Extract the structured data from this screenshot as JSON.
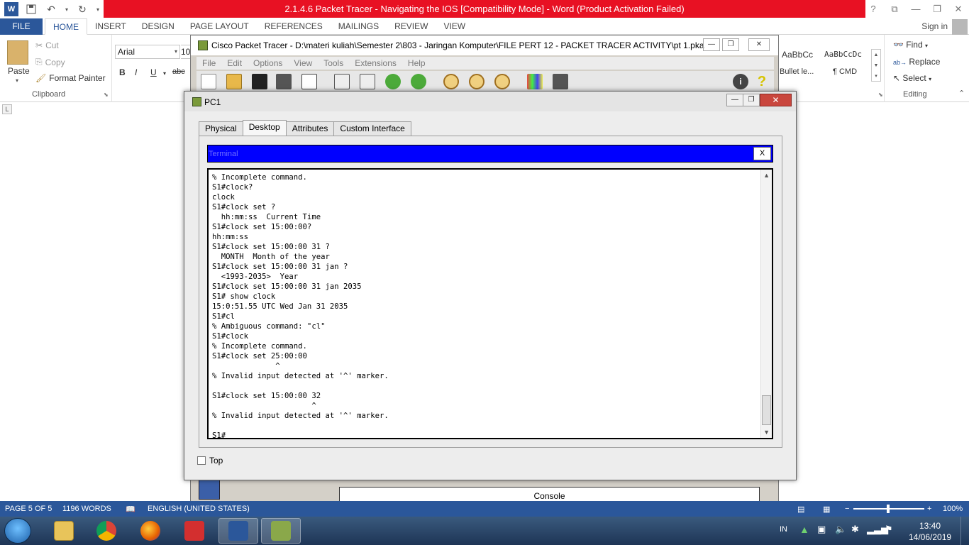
{
  "word": {
    "title": "2.1.4.6 Packet Tracer - Navigating the IOS [Compatibility Mode] -  Word (Product Activation Failed)",
    "controls": {
      "help": "?",
      "ribbon_opts": "⧉",
      "minimize": "—",
      "restore": "❐",
      "close": "✕"
    },
    "tabs": {
      "file": "FILE",
      "items": [
        "HOME",
        "INSERT",
        "DESIGN",
        "PAGE LAYOUT",
        "REFERENCES",
        "MAILINGS",
        "REVIEW",
        "VIEW"
      ]
    },
    "signin": "Sign in",
    "clipboard": {
      "paste": "Paste",
      "cut": "Cut",
      "copy": "Copy",
      "format_painter": "Format Painter",
      "label": "Clipboard"
    },
    "font": {
      "name": "Arial",
      "size": "10",
      "bold": "B",
      "italic": "I",
      "underline": "U",
      "strike": "abc"
    },
    "styles": {
      "style1_preview": "AaBbCc",
      "style1_name": "Bullet le...",
      "style2_preview": "AaBbCcDc",
      "style2_name": "¶ CMD"
    },
    "editing": {
      "find": "Find",
      "replace": "Replace",
      "select": "Select",
      "label": "Editing"
    },
    "ruler_tab": "L",
    "status": {
      "page": "PAGE 5 OF 5",
      "words": "1196 WORDS",
      "language": "ENGLISH (UNITED STATES)",
      "zoom": "100%"
    }
  },
  "packet_tracer": {
    "title": "Cisco Packet Tracer - D:\\materi kuliah\\Semester 2\\803 - Jaringan Komputer\\FILE PERT 12 - PACKET TRACER ACTIVITY\\pt 1.pka",
    "menus": [
      "File",
      "Edit",
      "Options",
      "View",
      "Tools",
      "Extensions",
      "Help"
    ],
    "console_label": "Console"
  },
  "pc1": {
    "title": "PC1",
    "tabs": [
      "Physical",
      "Desktop",
      "Attributes",
      "Custom Interface"
    ],
    "active_tab": "Desktop",
    "terminal_title": "Terminal",
    "terminal_close": "X",
    "terminal_lines": [
      "% Incomplete command.",
      "S1#clock?",
      "clock",
      "S1#clock set ?",
      "  hh:mm:ss  Current Time",
      "S1#clock set 15:00:00?",
      "hh:mm:ss",
      "S1#clock set 15:00:00 31 ?",
      "  MONTH  Month of the year",
      "S1#clock set 15:00:00 31 jan ?",
      "  <1993-2035>  Year",
      "S1#clock set 15:00:00 31 jan 2035",
      "S1# show clock",
      "15:0:51.55 UTC Wed Jan 31 2035",
      "S1#cl",
      "% Ambiguous command: \"cl\"",
      "S1#clock",
      "% Incomplete command.",
      "S1#clock set 25:00:00",
      "              ^",
      "% Invalid input detected at '^' marker.",
      "",
      "S1#clock set 15:00:00 32",
      "                      ^",
      "% Invalid input detected at '^' marker.",
      "",
      "S1#"
    ],
    "top_label": "Top",
    "top_checked": false
  },
  "taskbar": {
    "lang": "IN",
    "time": "13:40",
    "date": "14/06/2019"
  },
  "colors": {
    "word_blue": "#2b579a",
    "activation_red": "#e81123",
    "terminal_header": "#0000ff"
  }
}
